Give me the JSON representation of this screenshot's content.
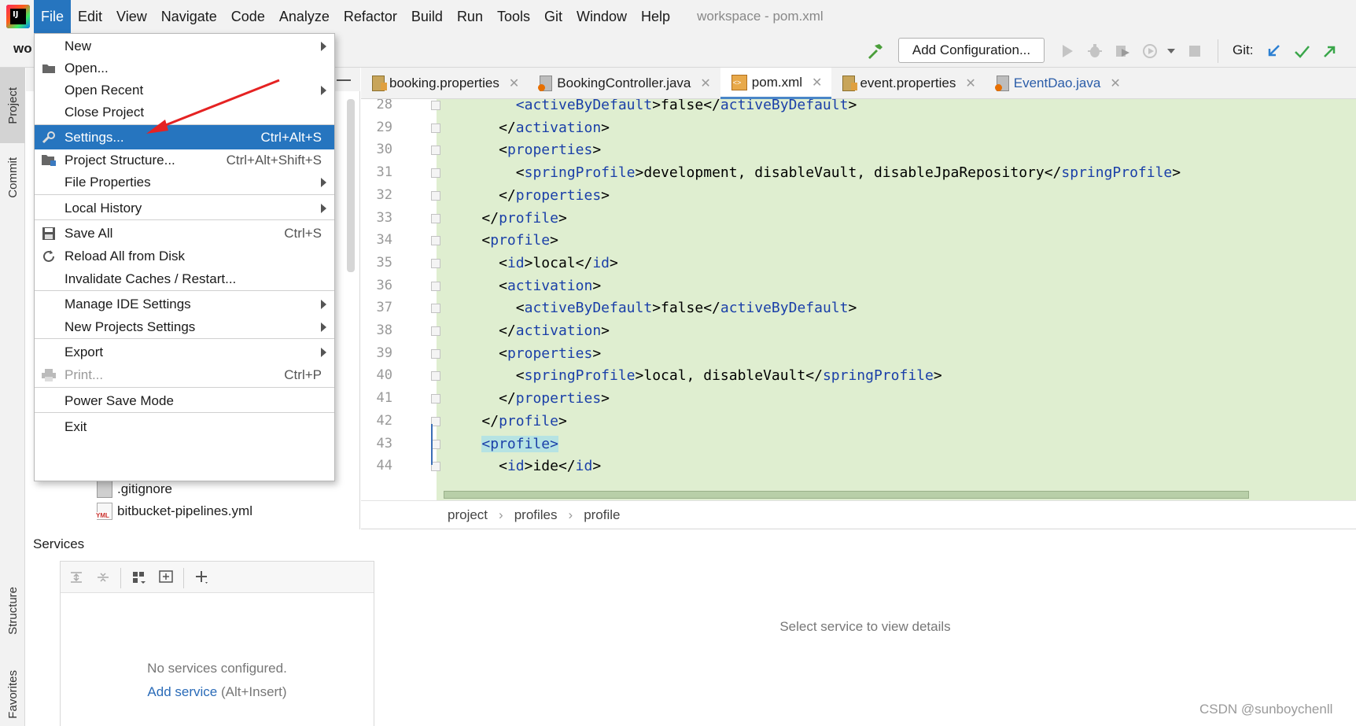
{
  "menubar": {
    "items": [
      "File",
      "Edit",
      "View",
      "Navigate",
      "Code",
      "Analyze",
      "Refactor",
      "Build",
      "Run",
      "Tools",
      "Git",
      "Window",
      "Help"
    ],
    "title": "workspace - pom.xml"
  },
  "toolbar": {
    "project_crumb": "wo",
    "add_configuration": "Add Configuration...",
    "git_label": "Git:"
  },
  "left_strip": {
    "tabs": [
      "Project",
      "Commit",
      "Structure",
      "Favorites"
    ]
  },
  "file_menu": {
    "items": [
      {
        "label": "New",
        "shortcut": "",
        "submenu": true
      },
      {
        "label": "Open...",
        "shortcut": "",
        "submenu": false
      },
      {
        "label": "Open Recent",
        "shortcut": "",
        "submenu": true
      },
      {
        "label": "Close Project",
        "shortcut": "",
        "submenu": false
      },
      {
        "label": "Settings...",
        "shortcut": "Ctrl+Alt+S",
        "submenu": false
      },
      {
        "label": "Project Structure...",
        "shortcut": "Ctrl+Alt+Shift+S",
        "submenu": false
      },
      {
        "label": "File Properties",
        "shortcut": "",
        "submenu": true
      },
      {
        "label": "Local History",
        "shortcut": "",
        "submenu": true
      },
      {
        "label": "Save All",
        "shortcut": "Ctrl+S",
        "submenu": false
      },
      {
        "label": "Reload All from Disk",
        "shortcut": "",
        "submenu": false
      },
      {
        "label": "Invalidate Caches / Restart...",
        "shortcut": "",
        "submenu": false
      },
      {
        "label": "Manage IDE Settings",
        "shortcut": "",
        "submenu": true
      },
      {
        "label": "New Projects Settings",
        "shortcut": "",
        "submenu": true
      },
      {
        "label": "Export",
        "shortcut": "",
        "submenu": true
      },
      {
        "label": "Print...",
        "shortcut": "Ctrl+P",
        "submenu": false
      },
      {
        "label": "Power Save Mode",
        "shortcut": "",
        "submenu": false
      },
      {
        "label": "Exit",
        "shortcut": "",
        "submenu": false
      }
    ]
  },
  "project_tree": {
    "items": [
      ".gitignore",
      "bitbucket-pipelines.yml"
    ],
    "yml_badge": "YML"
  },
  "editor_tabs": [
    {
      "label": "booking.properties"
    },
    {
      "label": "BookingController.java"
    },
    {
      "label": "pom.xml"
    },
    {
      "label": "event.properties"
    },
    {
      "label": "EventDao.java"
    }
  ],
  "editor": {
    "lines": [
      {
        "n": "28",
        "indent": 8,
        "code": [
          [
            "tag",
            "<activeByDefault"
          ],
          [
            "txt",
            ">false</"
          ],
          [
            "tag",
            "activeByDefault"
          ],
          [
            "txt",
            ">"
          ]
        ]
      },
      {
        "n": "29",
        "indent": 6,
        "code": [
          [
            "txt",
            "</"
          ],
          [
            "tag",
            "activation"
          ],
          [
            "txt",
            ">"
          ]
        ]
      },
      {
        "n": "30",
        "indent": 6,
        "code": [
          [
            "txt",
            "<"
          ],
          [
            "tag",
            "properties"
          ],
          [
            "txt",
            ">"
          ]
        ]
      },
      {
        "n": "31",
        "indent": 8,
        "code": [
          [
            "txt",
            "<"
          ],
          [
            "tag",
            "springProfile"
          ],
          [
            "txt",
            ">development, disableVault, disableJpaRepository</"
          ],
          [
            "tag",
            "springProfile"
          ],
          [
            "txt",
            ">"
          ]
        ]
      },
      {
        "n": "32",
        "indent": 6,
        "code": [
          [
            "txt",
            "</"
          ],
          [
            "tag",
            "properties"
          ],
          [
            "txt",
            ">"
          ]
        ]
      },
      {
        "n": "33",
        "indent": 4,
        "code": [
          [
            "txt",
            "</"
          ],
          [
            "tag",
            "profile"
          ],
          [
            "txt",
            ">"
          ]
        ]
      },
      {
        "n": "34",
        "indent": 4,
        "code": [
          [
            "txt",
            "<"
          ],
          [
            "tag",
            "profile"
          ],
          [
            "txt",
            ">"
          ]
        ]
      },
      {
        "n": "35",
        "indent": 6,
        "code": [
          [
            "txt",
            "<"
          ],
          [
            "tag",
            "id"
          ],
          [
            "txt",
            ">local</"
          ],
          [
            "tag",
            "id"
          ],
          [
            "txt",
            ">"
          ]
        ]
      },
      {
        "n": "36",
        "indent": 6,
        "code": [
          [
            "txt",
            "<"
          ],
          [
            "tag",
            "activation"
          ],
          [
            "txt",
            ">"
          ]
        ]
      },
      {
        "n": "37",
        "indent": 8,
        "code": [
          [
            "txt",
            "<"
          ],
          [
            "tag",
            "activeByDefault"
          ],
          [
            "txt",
            ">false</"
          ],
          [
            "tag",
            "activeByDefault"
          ],
          [
            "txt",
            ">"
          ]
        ]
      },
      {
        "n": "38",
        "indent": 6,
        "code": [
          [
            "txt",
            "</"
          ],
          [
            "tag",
            "activation"
          ],
          [
            "txt",
            ">"
          ]
        ]
      },
      {
        "n": "39",
        "indent": 6,
        "code": [
          [
            "txt",
            "<"
          ],
          [
            "tag",
            "properties"
          ],
          [
            "txt",
            ">"
          ]
        ]
      },
      {
        "n": "40",
        "indent": 8,
        "code": [
          [
            "txt",
            "<"
          ],
          [
            "tag",
            "springProfile"
          ],
          [
            "txt",
            ">local, disableVault</"
          ],
          [
            "tag",
            "springProfile"
          ],
          [
            "txt",
            ">"
          ]
        ]
      },
      {
        "n": "41",
        "indent": 6,
        "code": [
          [
            "txt",
            "</"
          ],
          [
            "tag",
            "properties"
          ],
          [
            "txt",
            ">"
          ]
        ]
      },
      {
        "n": "42",
        "indent": 4,
        "code": [
          [
            "txt",
            "</"
          ],
          [
            "tag",
            "profile"
          ],
          [
            "txt",
            ">"
          ]
        ]
      },
      {
        "n": "43",
        "indent": 4,
        "code": [
          [
            "hl",
            "<profile>"
          ]
        ]
      },
      {
        "n": "44",
        "indent": 6,
        "code": [
          [
            "txt",
            "<"
          ],
          [
            "tag",
            "id"
          ],
          [
            "txt",
            ">ide</"
          ],
          [
            "tag",
            "id"
          ],
          [
            "txt",
            ">"
          ]
        ]
      }
    ]
  },
  "breadcrumbs": [
    "project",
    "profiles",
    "profile"
  ],
  "services": {
    "title": "Services",
    "no_services": "No services configured.",
    "add_service": "Add service",
    "add_service_hint": " (Alt+Insert)",
    "detail": "Select service to view details"
  },
  "watermark": "CSDN @sunboychenll"
}
